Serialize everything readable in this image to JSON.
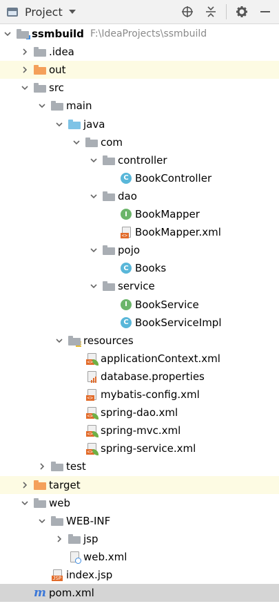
{
  "header": {
    "title": "Project",
    "icons": [
      "window-icon",
      "dropdown-caret-icon",
      "locate-icon",
      "collapse-icon",
      "gear-icon",
      "minimize-icon"
    ]
  },
  "tree": [
    {
      "label": "ssmbuild",
      "path": "F:\\IdeaProjects\\ssmbuild",
      "bold": true,
      "arrow": "down",
      "icon": "module-folder",
      "depth": 0
    },
    {
      "label": ".idea",
      "arrow": "right",
      "icon": "folder-grey",
      "depth": 1
    },
    {
      "label": "out",
      "arrow": "right",
      "icon": "folder-orange",
      "depth": 1,
      "highlight": true
    },
    {
      "label": "src",
      "arrow": "down",
      "icon": "folder-grey",
      "depth": 1
    },
    {
      "label": "main",
      "arrow": "down",
      "icon": "folder-grey",
      "depth": 2
    },
    {
      "label": "java",
      "arrow": "down",
      "icon": "folder-blue",
      "depth": 3
    },
    {
      "label": "com",
      "arrow": "down",
      "icon": "package",
      "depth": 4
    },
    {
      "label": "controller",
      "arrow": "down",
      "icon": "package",
      "depth": 5
    },
    {
      "label": "BookController",
      "arrow": "none",
      "icon": "class",
      "depth": 6
    },
    {
      "label": "dao",
      "arrow": "down",
      "icon": "package",
      "depth": 5
    },
    {
      "label": "BookMapper",
      "arrow": "none",
      "icon": "interface",
      "depth": 6
    },
    {
      "label": "BookMapper.xml",
      "arrow": "none",
      "icon": "xml",
      "depth": 6
    },
    {
      "label": "pojo",
      "arrow": "down",
      "icon": "package",
      "depth": 5
    },
    {
      "label": "Books",
      "arrow": "none",
      "icon": "class",
      "depth": 6
    },
    {
      "label": "service",
      "arrow": "down",
      "icon": "package",
      "depth": 5
    },
    {
      "label": "BookService",
      "arrow": "none",
      "icon": "interface",
      "depth": 6
    },
    {
      "label": "BookServiceImpl",
      "arrow": "none",
      "icon": "class",
      "depth": 6
    },
    {
      "label": "resources",
      "arrow": "down",
      "icon": "folder-resources",
      "depth": 3
    },
    {
      "label": "applicationContext.xml",
      "arrow": "none",
      "icon": "spring-xml",
      "depth": 4
    },
    {
      "label": "database.properties",
      "arrow": "none",
      "icon": "properties",
      "depth": 4
    },
    {
      "label": "mybatis-config.xml",
      "arrow": "none",
      "icon": "xml",
      "depth": 4
    },
    {
      "label": "spring-dao.xml",
      "arrow": "none",
      "icon": "spring-xml",
      "depth": 4
    },
    {
      "label": "spring-mvc.xml",
      "arrow": "none",
      "icon": "spring-xml",
      "depth": 4
    },
    {
      "label": "spring-service.xml",
      "arrow": "none",
      "icon": "spring-xml",
      "depth": 4
    },
    {
      "label": "test",
      "arrow": "right",
      "icon": "folder-grey",
      "depth": 2
    },
    {
      "label": "target",
      "arrow": "right",
      "icon": "folder-orange",
      "depth": 1,
      "highlight": true
    },
    {
      "label": "web",
      "arrow": "down",
      "icon": "folder-web",
      "depth": 1
    },
    {
      "label": "WEB-INF",
      "arrow": "down",
      "icon": "folder-grey",
      "depth": 2
    },
    {
      "label": "jsp",
      "arrow": "right",
      "icon": "folder-grey",
      "depth": 3
    },
    {
      "label": "web.xml",
      "arrow": "none",
      "icon": "web-xml",
      "depth": 3
    },
    {
      "label": "index.jsp",
      "arrow": "none",
      "icon": "jsp",
      "depth": 2
    },
    {
      "label": "pom.xml",
      "arrow": "none",
      "icon": "maven",
      "depth": 1,
      "selected": true
    }
  ],
  "badges": {
    "xml": "<>",
    "jsp": "JSP",
    "class": "C",
    "interface": "I",
    "maven": "m"
  }
}
